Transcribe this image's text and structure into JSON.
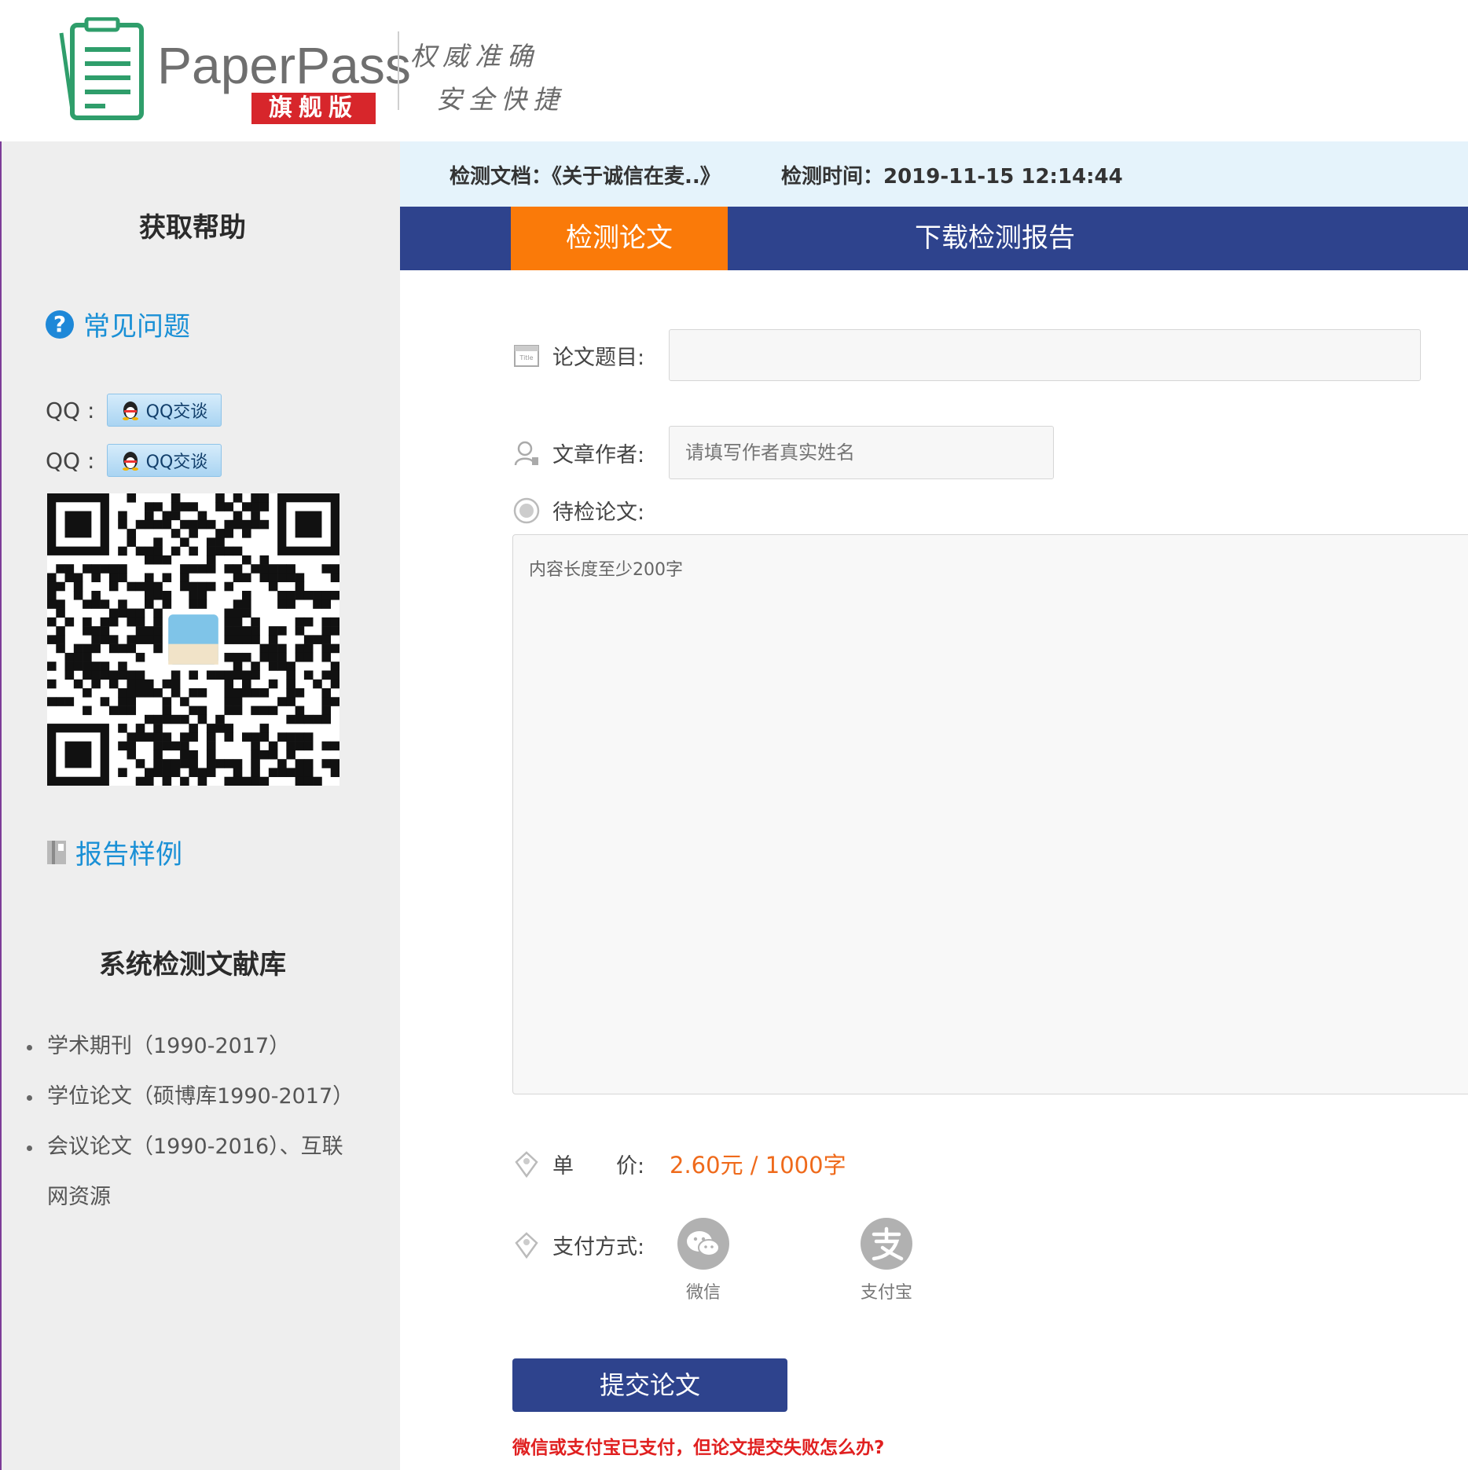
{
  "brand": {
    "name": "PaperPass",
    "edition": "旗舰版",
    "slogan_line1": "权威准确",
    "slogan_line2": "安全快捷"
  },
  "sidebar": {
    "help_title": "获取帮助",
    "faq_label": "常见问题",
    "qq": [
      {
        "label": "QQ :",
        "button": "QQ交谈"
      },
      {
        "label": "QQ :",
        "button": "QQ交谈"
      }
    ],
    "sample_label": "报告样例",
    "library_title": "系统检测文献库",
    "library_items": [
      "学术期刊（1990-2017）",
      "学位论文（硕博库1990-2017）",
      "会议论文（1990-2016）、互联网资源"
    ]
  },
  "info": {
    "doc": "检测文档：《关于诚信在麦..》",
    "time": "检测时间：2019-11-15 12:14:44"
  },
  "tabs": [
    {
      "label": "检测论文",
      "active": true
    },
    {
      "label": "下载检测报告",
      "active": false
    }
  ],
  "form": {
    "title_label": "论文题目:",
    "title_value": "",
    "author_label": "文章作者:",
    "author_placeholder": "请填写作者真实姓名",
    "content_label": "待检论文:",
    "content_placeholder": "内容长度至少200字",
    "price_label": "单　　价:",
    "price_value": "2.60元 / 1000字",
    "pay_label": "支付方式:",
    "pay_options": [
      {
        "label": "微信",
        "icon": "wechat-icon"
      },
      {
        "label": "支付宝",
        "icon": "alipay-icon"
      }
    ],
    "submit": "提交论文",
    "help_link": "微信或支付宝已支付，但论文提交失败怎么办?"
  },
  "colors": {
    "nav": "#2e438d",
    "active_tab": "#fa7a09",
    "link": "#1a90d6",
    "price": "#ef6a1b",
    "alert": "#e02020"
  }
}
